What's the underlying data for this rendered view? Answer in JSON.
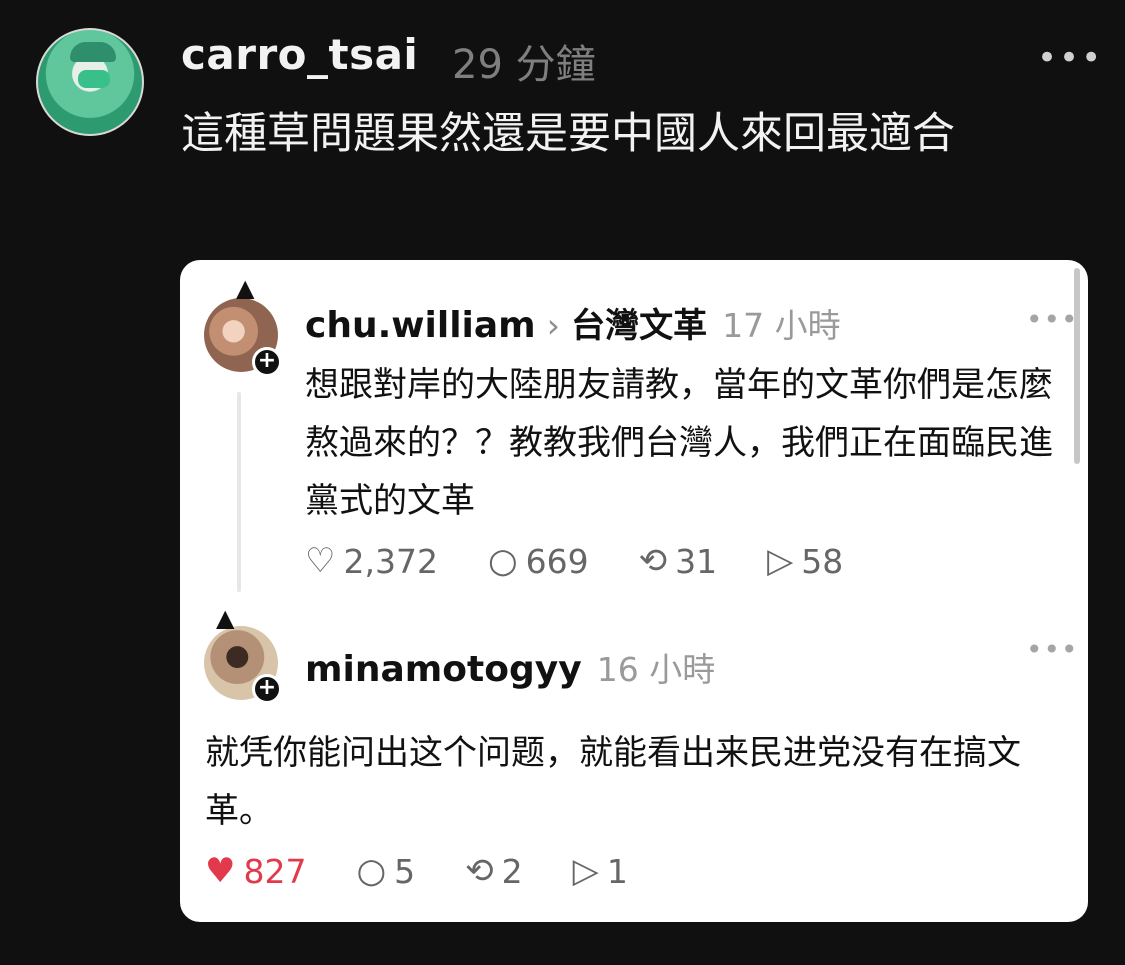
{
  "outer": {
    "username": "carro_tsai",
    "time": "29 分鐘",
    "more": "•••",
    "text": "這種草問題果然還是要中國人來回最適合"
  },
  "quoted": {
    "post1": {
      "username": "chu.william",
      "separator": "›",
      "topic": "台灣文革",
      "time": "17 小時",
      "more": "•••",
      "text": "想跟對岸的大陸朋友請教，當年的文革你們是怎麼熬過來的？？教教我們台灣人，我們正在面臨民進黨式的文革",
      "likes": "2,372",
      "comments": "669",
      "reposts": "31",
      "shares": "58"
    },
    "post2": {
      "username": "minamotogyy",
      "time": "16 小時",
      "more": "•••",
      "text": "就凭你能问出这个问题，就能看出来民进党没有在搞文革。",
      "likes": "827",
      "comments": "5",
      "reposts": "2",
      "shares": "1"
    }
  },
  "icons": {
    "heart": "heart-icon",
    "comment": "comment-icon",
    "repost": "repost-icon",
    "share": "share-icon",
    "plus": "follow-plus-icon",
    "party": "party-hat-icon",
    "more": "more-icon"
  },
  "colors": {
    "background": "#101010",
    "card": "#ffffff",
    "liked_red": "#e23a4c"
  }
}
